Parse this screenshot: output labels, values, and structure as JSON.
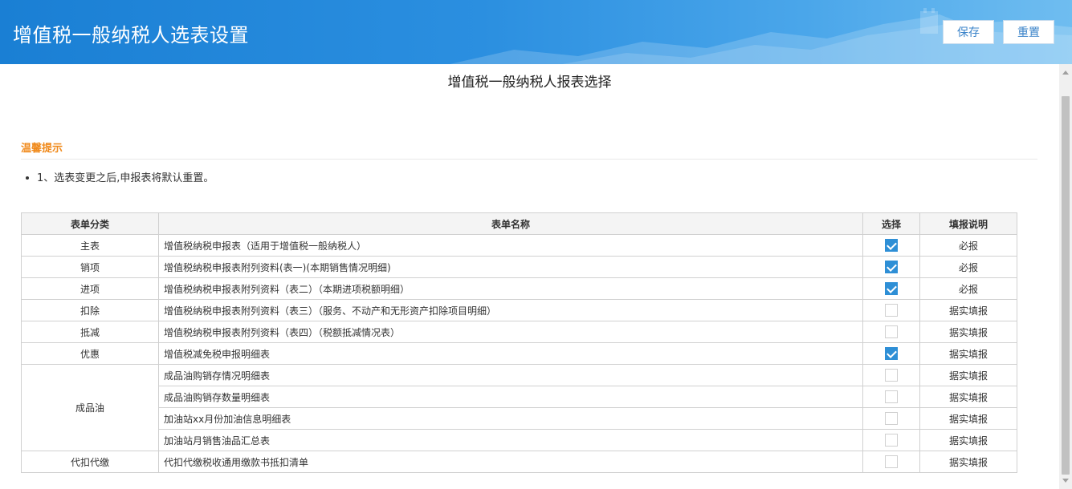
{
  "header": {
    "title": "增值税一般纳税人选表设置",
    "save_label": "保存",
    "reset_label": "重置"
  },
  "page_title": "增值税一般纳税人报表选择",
  "tips": {
    "title": "温馨提示",
    "items": [
      "1、选表变更之后,申报表将默认重置。"
    ]
  },
  "table": {
    "headers": {
      "category": "表单分类",
      "name": "表单名称",
      "select": "选择",
      "note": "填报说明"
    },
    "rows": [
      {
        "category": "主表",
        "name": "增值税纳税申报表（适用于增值税一般纳税人）",
        "checked": true,
        "note": "必报"
      },
      {
        "category": "销项",
        "name": "增值税纳税申报表附列资料(表一)(本期销售情况明细)",
        "checked": true,
        "note": "必报"
      },
      {
        "category": "进项",
        "name": "增值税纳税申报表附列资料（表二）（本期进项税额明细）",
        "checked": true,
        "note": "必报"
      },
      {
        "category": "扣除",
        "name": "增值税纳税申报表附列资料（表三）（服务、不动产和无形资产扣除项目明细）",
        "checked": false,
        "note": "据实填报"
      },
      {
        "category": "抵减",
        "name": "增值税纳税申报表附列资料（表四）（税额抵减情况表）",
        "checked": false,
        "note": "据实填报"
      },
      {
        "category": "优惠",
        "name": "增值税减免税申报明细表",
        "checked": true,
        "note": "据实填报"
      },
      {
        "category": "成品油",
        "name": "成品油购销存情况明细表",
        "checked": false,
        "note": "据实填报"
      },
      {
        "category": "",
        "name": "成品油购销存数量明细表",
        "checked": false,
        "note": "据实填报"
      },
      {
        "category": "",
        "name": "加油站xx月份加油信息明细表",
        "checked": false,
        "note": "据实填报"
      },
      {
        "category": "",
        "name": "加油站月销售油品汇总表",
        "checked": false,
        "note": "据实填报"
      },
      {
        "category": "代扣代缴",
        "name": "代扣代缴税收通用缴款书抵扣清单",
        "checked": false,
        "note": "据实填报"
      }
    ]
  },
  "colors": {
    "header_blue": "#1a7fd4",
    "tip_orange": "#f08a1c",
    "checkbox_blue": "#2e8fd6"
  }
}
